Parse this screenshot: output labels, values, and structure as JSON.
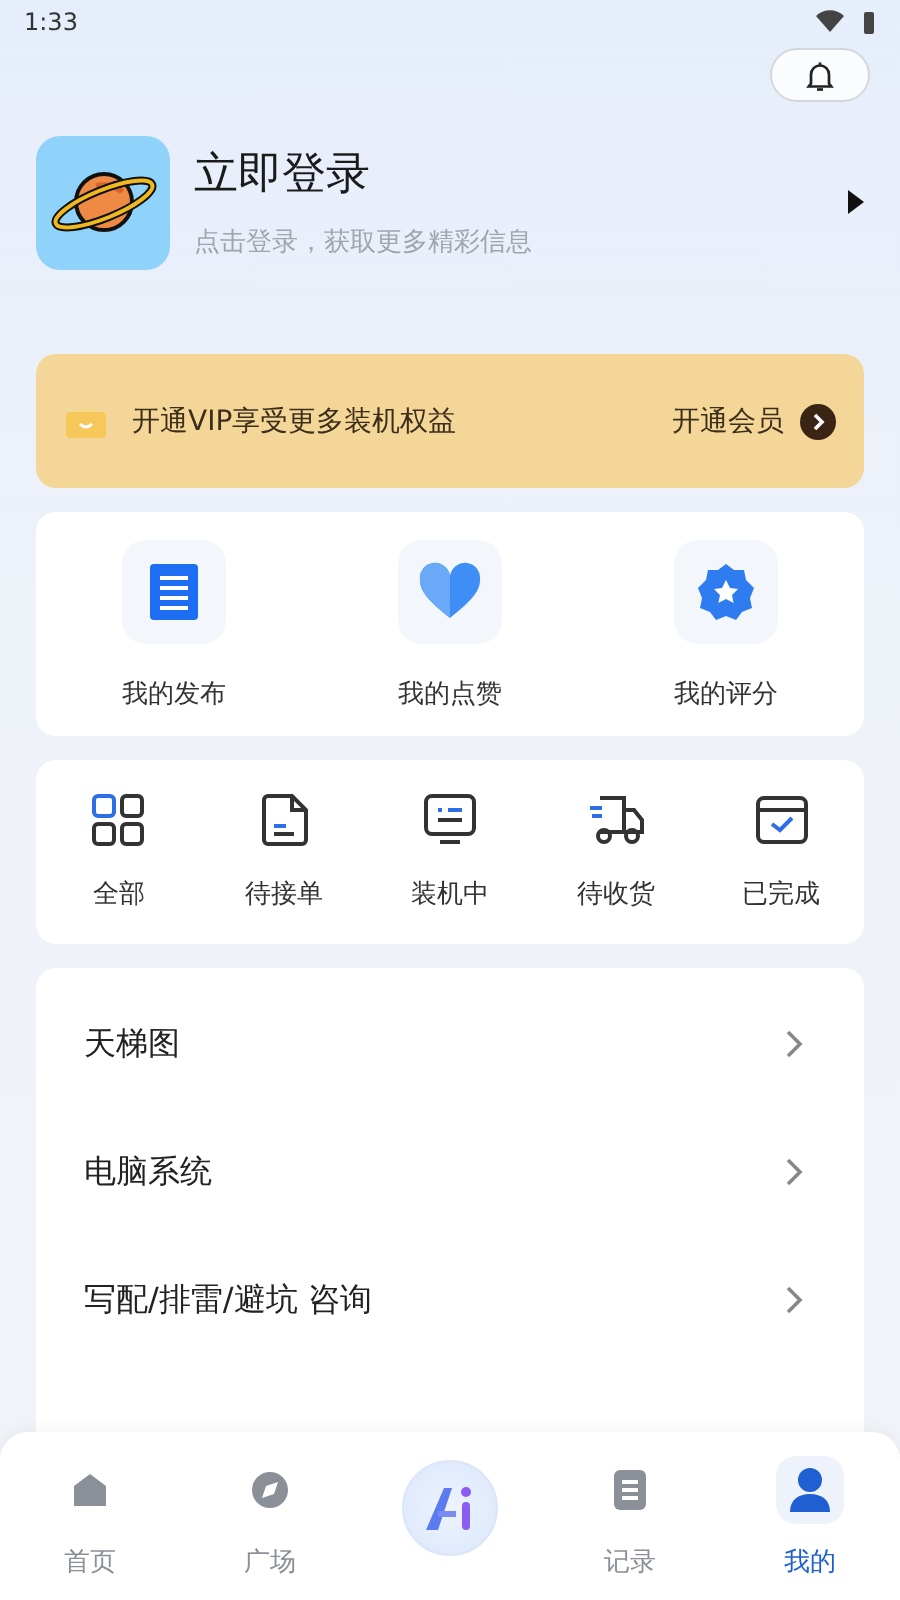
{
  "status_bar": {
    "time": "1:33"
  },
  "profile": {
    "title": "立即登录",
    "subtitle": "点击登录，获取更多精彩信息"
  },
  "vip_banner": {
    "text": "开通VIP享受更多装机权益",
    "action": "开通会员"
  },
  "quick_links": [
    {
      "label": "我的发布"
    },
    {
      "label": "我的点赞"
    },
    {
      "label": "我的评分"
    }
  ],
  "orders": [
    {
      "label": "全部"
    },
    {
      "label": "待接单"
    },
    {
      "label": "装机中"
    },
    {
      "label": "待收货"
    },
    {
      "label": "已完成"
    }
  ],
  "menu": [
    {
      "label": "天梯图"
    },
    {
      "label": "电脑系统"
    },
    {
      "label": "写配/排雷/避坑 咨询"
    }
  ],
  "nav": [
    {
      "label": "首页",
      "selected": false
    },
    {
      "label": "广场",
      "selected": false
    },
    {
      "label": "记录",
      "selected": false
    },
    {
      "label": "我的",
      "selected": true
    }
  ]
}
